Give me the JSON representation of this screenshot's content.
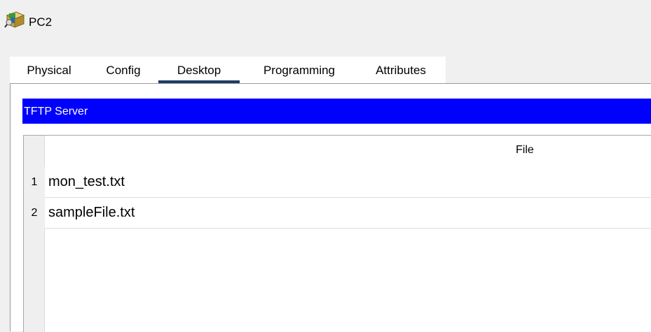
{
  "window": {
    "title": "PC2",
    "icon": "packet-tracer-pc-icon"
  },
  "tabs": [
    {
      "label": "Physical",
      "active": false
    },
    {
      "label": "Config",
      "active": false
    },
    {
      "label": "Desktop",
      "active": true
    },
    {
      "label": "Programming",
      "active": false
    },
    {
      "label": "Attributes",
      "active": false
    }
  ],
  "panel": {
    "title": "TFTP Server",
    "header_color": "#0000ff"
  },
  "file_table": {
    "column_header": "File",
    "rows": [
      {
        "index": "1",
        "file": "mon_test.txt"
      },
      {
        "index": "2",
        "file": "sampleFile.txt"
      }
    ]
  }
}
